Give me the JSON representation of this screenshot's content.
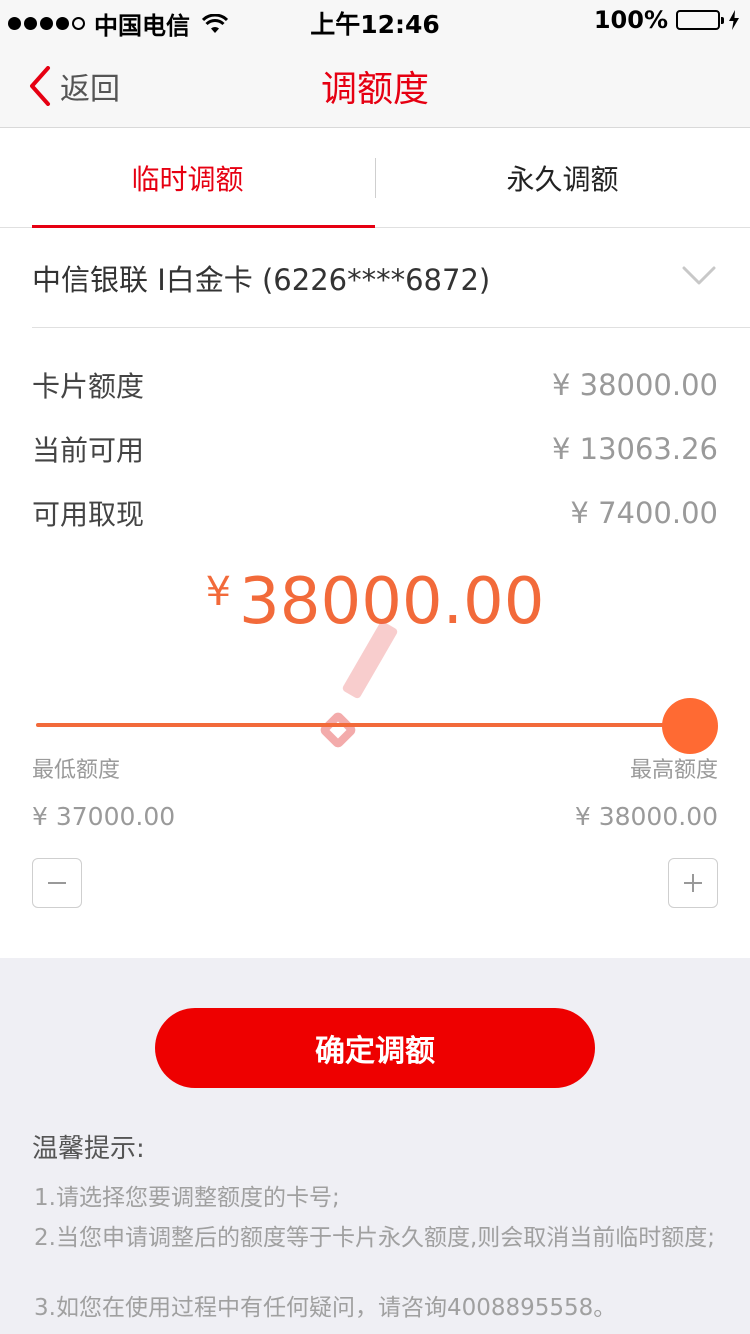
{
  "status_bar": {
    "carrier": "中国电信",
    "time": "上午12:46",
    "battery": "100%"
  },
  "nav": {
    "back_label": "返回",
    "title": "调额度"
  },
  "tabs": [
    {
      "label": "临时调额",
      "active": true
    },
    {
      "label": "永久调额",
      "active": false
    }
  ],
  "card": {
    "name": "中信银联  I白金卡 (6226****6872)"
  },
  "info": [
    {
      "label": "卡片额度",
      "value": "¥ 38000.00"
    },
    {
      "label": "当前可用",
      "value": "¥ 13063.26"
    },
    {
      "label": "可用取现",
      "value": "¥ 7400.00"
    }
  ],
  "amount": {
    "currency": "¥",
    "value": "38000.00"
  },
  "slider": {
    "level": 1.0
  },
  "range": {
    "min_label": "最低额度",
    "max_label": "最高额度",
    "min_value": "¥ 37000.00",
    "max_value": "¥ 38000.00"
  },
  "confirm_label": "确定调额",
  "tips": {
    "title": "温馨提示:",
    "items": [
      "1.请选择您要调整额度的卡号;",
      "2.当您申请调整后的额度等于卡片永久额度,则会取消当前临时额度;",
      "3.如您在使用过程中有任何疑问，请咨询4008895558。"
    ]
  },
  "colors": {
    "brand_red": "#e60012",
    "accent_orange": "#f26a3a",
    "button_red": "#ee0000"
  },
  "icons": [
    "back-chevron-icon",
    "chevron-down-icon",
    "minus-icon",
    "plus-icon",
    "wifi-icon",
    "battery-icon",
    "charging-bolt-icon"
  ]
}
